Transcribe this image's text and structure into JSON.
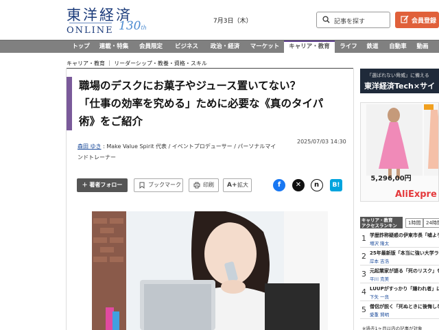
{
  "header": {
    "logo_kanji": "東洋経済",
    "logo_online": "ONLINE",
    "logo_anniv": "130",
    "logo_anniv_suffix": "th",
    "date": "7月3日（木）",
    "search_placeholder": "記事を探す",
    "member_label": "会員登録"
  },
  "nav": {
    "items": [
      {
        "label": "トップ"
      },
      {
        "label": "連載・特集"
      },
      {
        "label": "会員限定"
      },
      {
        "label": "ビジネス"
      },
      {
        "label": "政治・経済"
      },
      {
        "label": "マーケット"
      },
      {
        "label": "キャリア・教育",
        "active": true
      },
      {
        "label": "ライフ"
      },
      {
        "label": "鉄道"
      },
      {
        "label": "自動車"
      },
      {
        "label": "動画"
      }
    ]
  },
  "breadcrumb": "キャリア・教育 ｜ リーダーシップ・教養・資格・スキル",
  "article": {
    "title_lines": [
      "職場のデスクにお菓子やジュース置いてない？",
      "「仕事の効率を究める」ために必要な《真のタイパ",
      "術》をご紹介"
    ],
    "author_name": "森田 ゆき",
    "author_desc": " : Make Value Spirit 代表 / イベントプロデューサー / パーソナルマインドトレーナー",
    "datetime": "2025/07/03 14:30"
  },
  "actions": {
    "follow": "＋ 著者フォロー",
    "bookmark": "ブックマーク",
    "print": "印刷",
    "enlarge": "拡大"
  },
  "sidebar": {
    "banner_sub": "「選ばれない脅威」に備える",
    "banner_main": "東洋経済Tech×サイ",
    "ad_price": "5,296,00円",
    "ad_brand": "AliExpre",
    "ranking_title_line1": "キャリア・教育",
    "ranking_title_line2": "アクセスランキング",
    "ranking_tabs": [
      "1時間",
      "24時間"
    ],
    "ranking": [
      {
        "num": "1",
        "text": "学歴詐称疑惑の伊東市長「嘘より",
        "author": "増沢 隆太"
      },
      {
        "num": "2",
        "text": "25年最新版「本当に強い大学ラン",
        "author": "岸本 吉浩"
      },
      {
        "num": "3",
        "text": "元起業家が語る「死のリスク」をも",
        "author": "平川 克美"
      },
      {
        "num": "4",
        "text": "LUUPがすっかり「嫌われ者」にな",
        "author": "下矢 一良"
      },
      {
        "num": "5",
        "text": "僧侶が説く「死ぬときに後悔しな",
        "author": "愛重 賢明"
      }
    ],
    "ranking_foot": "※過去1ヶ月以内の記事が対象"
  },
  "colors": {
    "accent_orange": "#e0603a",
    "nav_gray": "#808080",
    "title_bar_purple": "#7a5a9a",
    "facebook": "#1877f2",
    "hatena": "#00a4de"
  }
}
